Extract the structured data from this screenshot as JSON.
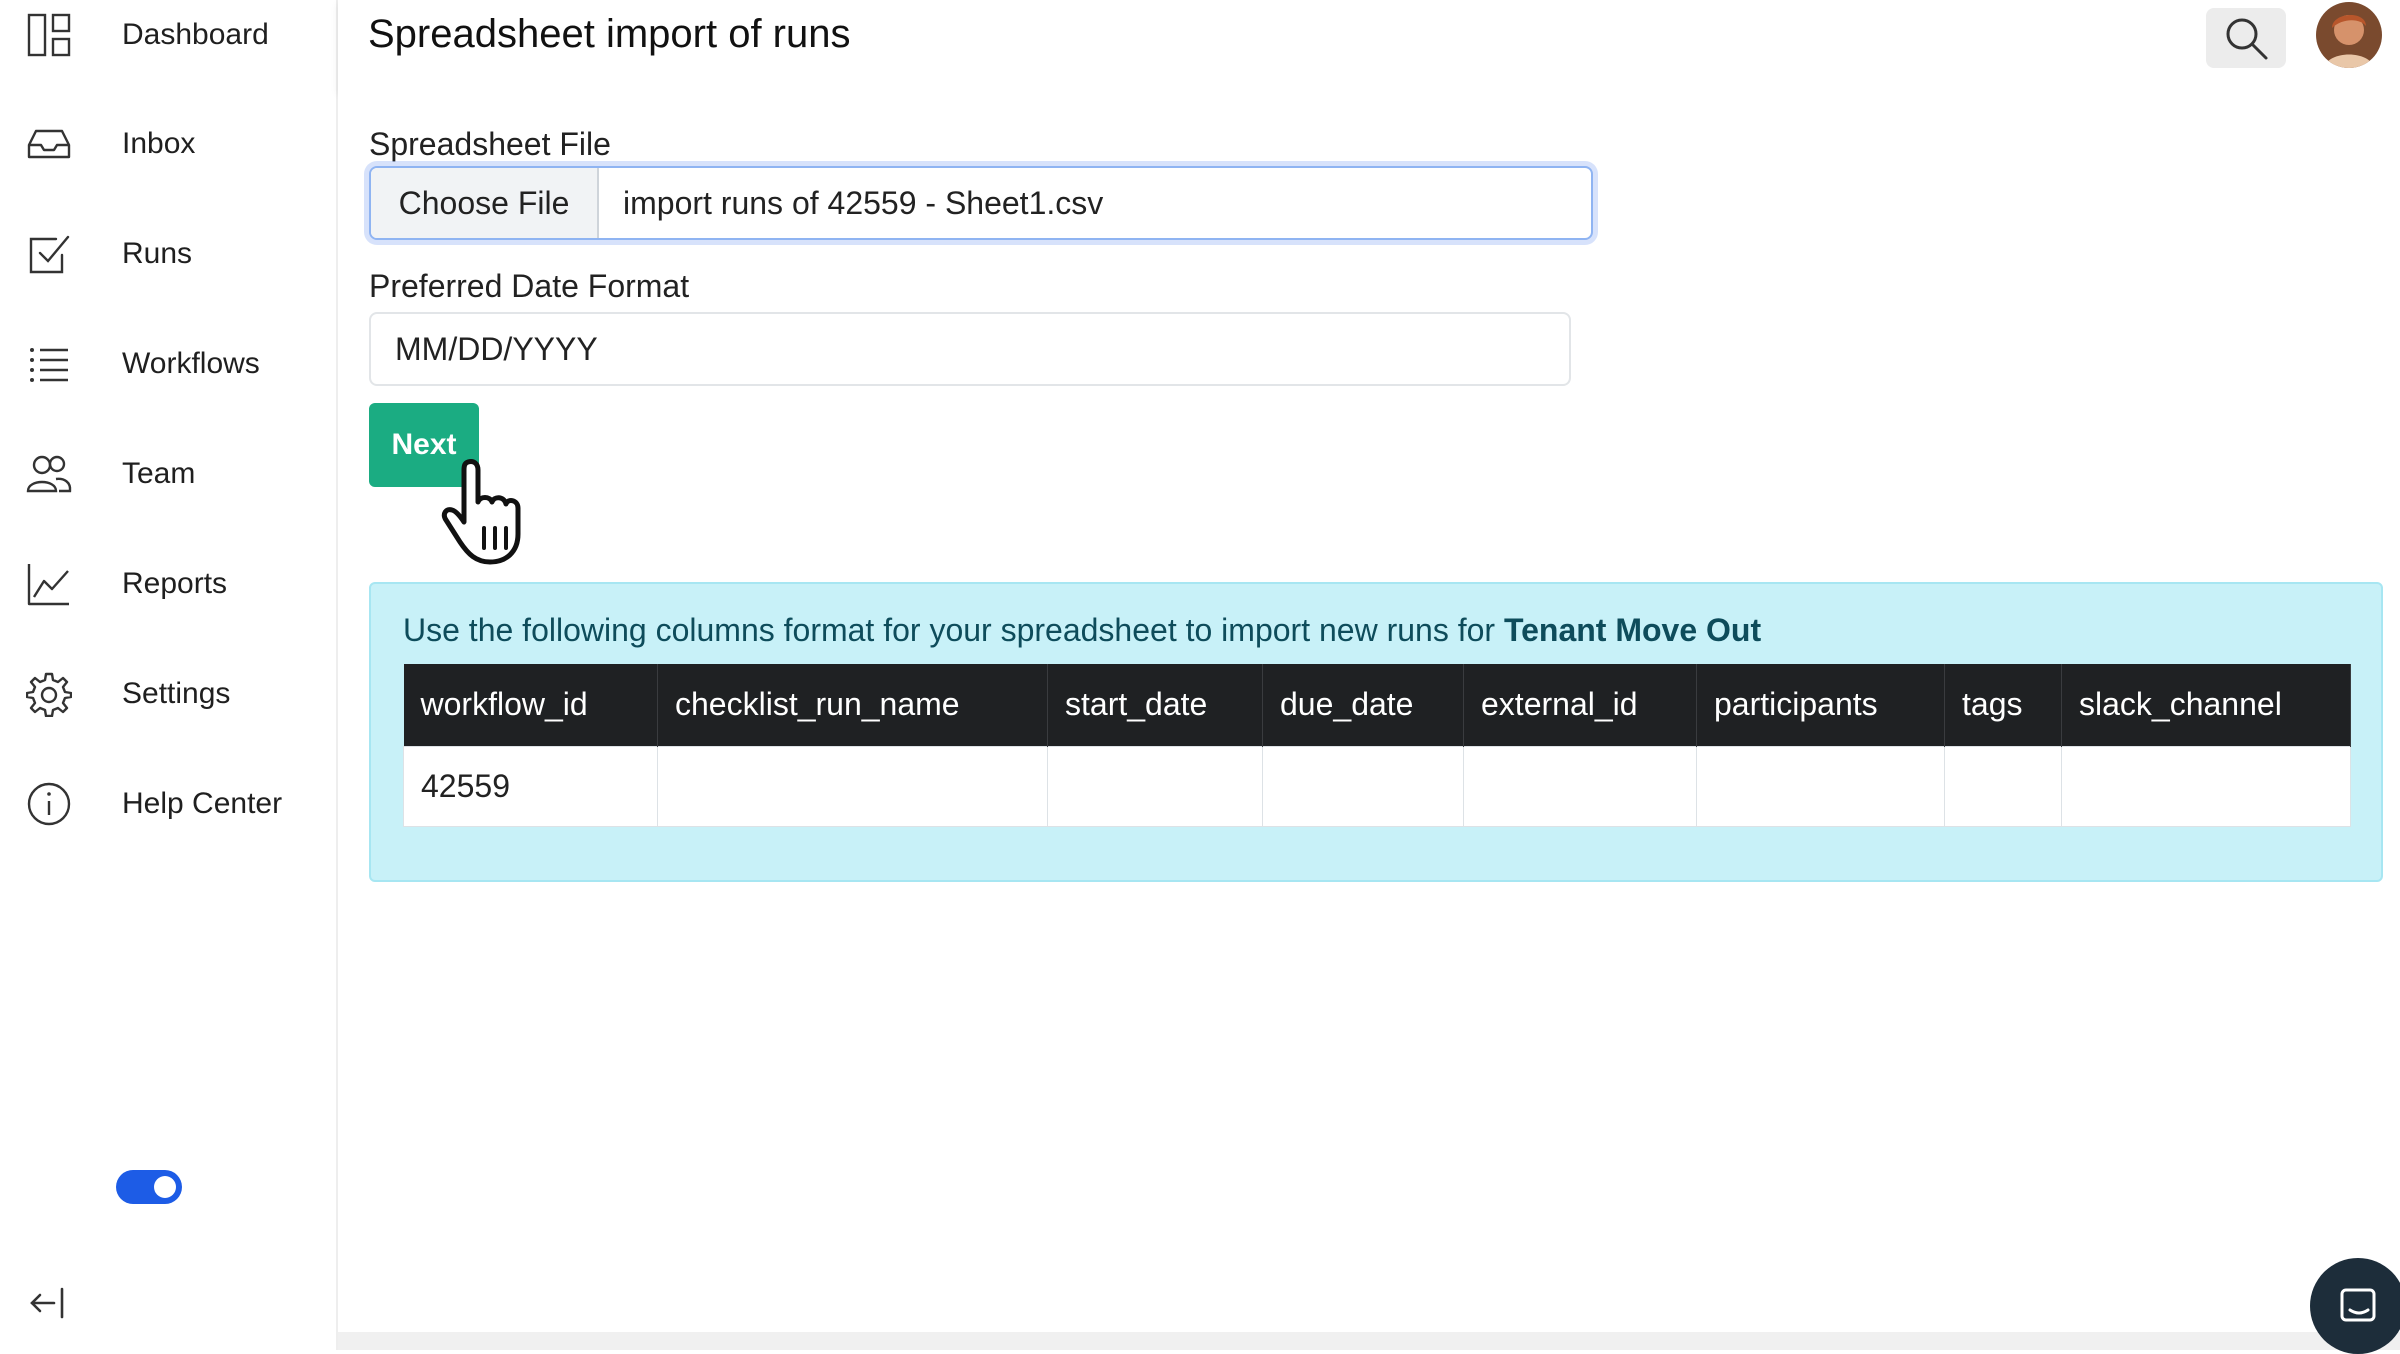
{
  "sidebar": {
    "items": [
      {
        "label": "Dashboard",
        "icon": "dashboard-icon"
      },
      {
        "label": "Inbox",
        "icon": "inbox-icon"
      },
      {
        "label": "Runs",
        "icon": "checkbox-icon"
      },
      {
        "label": "Workflows",
        "icon": "list-icon"
      },
      {
        "label": "Team",
        "icon": "team-icon"
      },
      {
        "label": "Reports",
        "icon": "chart-icon"
      },
      {
        "label": "Settings",
        "icon": "gear-icon"
      },
      {
        "label": "Help Center",
        "icon": "info-icon"
      }
    ],
    "toggle_on": true
  },
  "header": {
    "title": "Spreadsheet import of runs"
  },
  "form": {
    "file_label": "Spreadsheet File",
    "choose_file_label": "Choose File",
    "file_name": "import runs of 42559 - Sheet1.csv",
    "date_format_label": "Preferred Date Format",
    "date_format_value": "MM/DD/YYYY",
    "next_label": "Next"
  },
  "info": {
    "text": "Use the following columns format for your spreadsheet to import new runs for ",
    "workflow_name": "Tenant Move Out",
    "columns": [
      "workflow_id",
      "checklist_run_name",
      "start_date",
      "due_date",
      "external_id",
      "participants",
      "tags",
      "slack_channel"
    ],
    "row": [
      "42559",
      "",
      "",
      "",
      "",
      "",
      "",
      ""
    ]
  },
  "colors": {
    "accent": "#1bac82",
    "toggle": "#1d5ce6",
    "info_bg": "#c8f1f8",
    "table_header": "#1f2123"
  }
}
